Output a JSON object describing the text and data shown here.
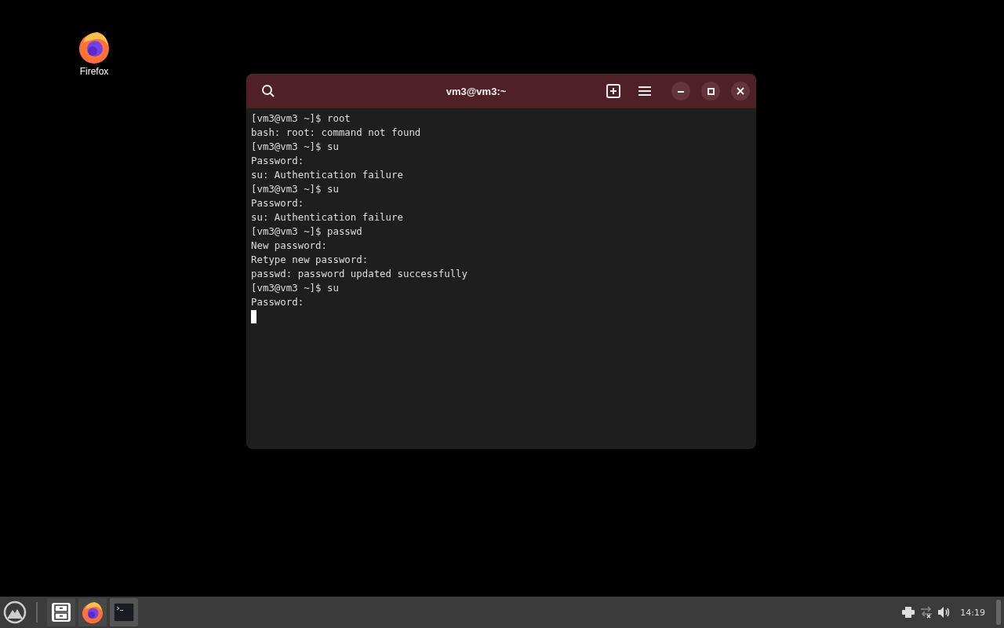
{
  "desktop_icons": [
    {
      "label": "Firefox"
    }
  ],
  "window": {
    "title": "vm3@vm3:~"
  },
  "terminal": {
    "lines": [
      "[vm3@vm3 ~]$ root",
      "bash: root: command not found",
      "[vm3@vm3 ~]$ su",
      "Password:",
      "su: Authentication failure",
      "[vm3@vm3 ~]$ su",
      "Password:",
      "su: Authentication failure",
      "[vm3@vm3 ~]$ passwd",
      "New password:",
      "Retype new password:",
      "passwd: password updated successfully",
      "[vm3@vm3 ~]$ su",
      "Password:"
    ],
    "cursor": true
  },
  "taskbar": {
    "apps": [
      {
        "kind": "files",
        "selected": false
      },
      {
        "kind": "firefox",
        "selected": false
      },
      {
        "kind": "terminal",
        "selected": true
      }
    ],
    "clock": "14:19"
  }
}
